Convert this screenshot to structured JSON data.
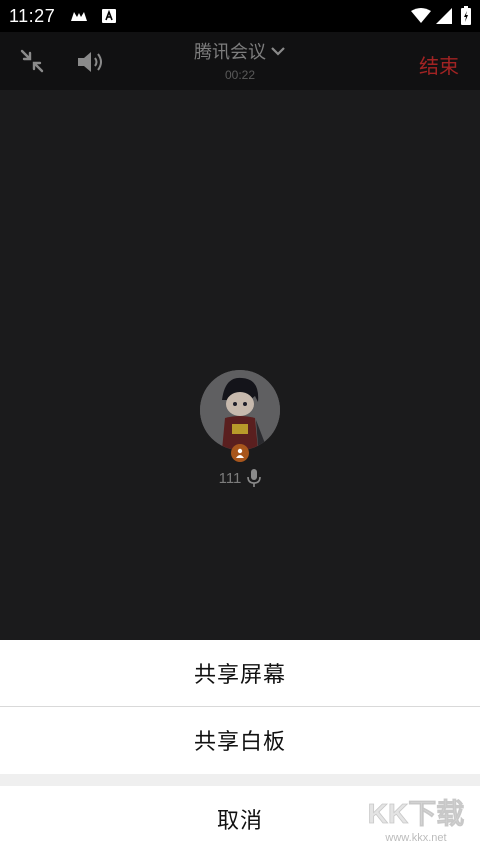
{
  "status_bar": {
    "time": "11:27"
  },
  "toolbar": {
    "title": "腾讯会议",
    "timer": "00:22",
    "end_label": "结束"
  },
  "participant": {
    "name": "111"
  },
  "sheet": {
    "share_screen": "共享屏幕",
    "share_whiteboard": "共享白板",
    "cancel": "取消"
  },
  "watermark": {
    "brand": "KK下载",
    "url": "www.kkx.net"
  },
  "colors": {
    "end": "#a12323",
    "badge": "#a8561c",
    "sheet_bg": "#ffffff"
  }
}
